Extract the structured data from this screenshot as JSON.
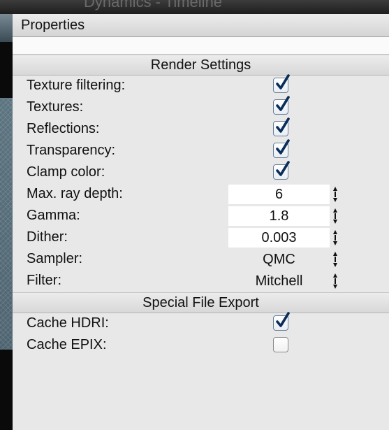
{
  "window": {
    "title": "Dynamics - Timeline"
  },
  "panel": {
    "title": "Properties"
  },
  "sections": {
    "render_settings": {
      "title": "Render Settings",
      "texture_filtering": {
        "label": "Texture filtering:",
        "checked": true
      },
      "textures": {
        "label": "Textures:",
        "checked": true
      },
      "reflections": {
        "label": "Reflections:",
        "checked": true
      },
      "transparency": {
        "label": "Transparency:",
        "checked": true
      },
      "clamp_color": {
        "label": "Clamp color:",
        "checked": true
      },
      "max_ray_depth": {
        "label": "Max. ray depth:",
        "value": "6"
      },
      "gamma": {
        "label": "Gamma:",
        "value": "1.8"
      },
      "dither": {
        "label": "Dither:",
        "value": "0.003"
      },
      "sampler": {
        "label": "Sampler:",
        "value": "QMC"
      },
      "filter": {
        "label": "Filter:",
        "value": "Mitchell"
      }
    },
    "special_file_export": {
      "title": "Special File Export",
      "cache_hdri": {
        "label": "Cache HDRI:",
        "checked": true
      },
      "cache_epix": {
        "label": "Cache EPIX:",
        "checked": false
      }
    }
  },
  "colors": {
    "panel_bg": "#e8e8e8",
    "checkbox_check": "#0a2d5a"
  }
}
